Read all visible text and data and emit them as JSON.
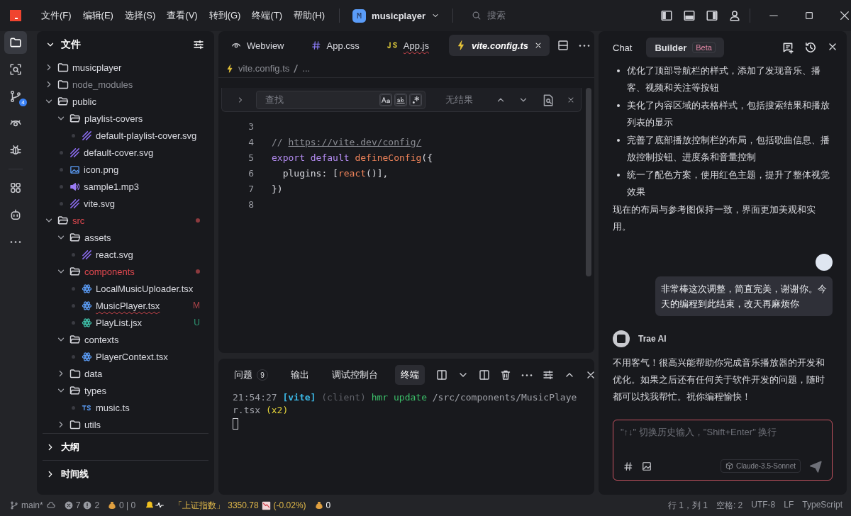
{
  "titlebar": {
    "menu": [
      "文件(F)",
      "编辑(E)",
      "选择(S)",
      "查看(V)",
      "转到(G)",
      "终端(T)",
      "帮助(H)"
    ],
    "project": {
      "initial": "M",
      "name": "musicplayer"
    },
    "search": {
      "placeholder": "搜索"
    }
  },
  "activity_bar": [
    {
      "kind": "files",
      "selected": true
    },
    {
      "kind": "search",
      "selected": false
    },
    {
      "kind": "git",
      "selected": false,
      "badge": "4"
    },
    {
      "kind": "remote",
      "selected": false
    },
    {
      "kind": "debug",
      "selected": false
    },
    {
      "kind": "extensions",
      "selected": false
    },
    {
      "kind": "robot",
      "selected": false
    },
    {
      "kind": "more",
      "selected": false
    }
  ],
  "explorer": {
    "title": "文件",
    "tree": [
      {
        "name": "musicplayer",
        "kind": "folder",
        "expanded": false,
        "problem": false,
        "ignored": false
      },
      {
        "name": "node_modules",
        "kind": "folder",
        "expanded": false,
        "problem": false,
        "ignored": true
      },
      {
        "name": "public",
        "kind": "folder",
        "expanded": true,
        "problem": false,
        "ignored": false,
        "children": [
          {
            "name": "playlist-covers",
            "kind": "folder",
            "expanded": true,
            "problem": false,
            "ignored": false,
            "children": [
              {
                "name": "default-playlist-cover.svg",
                "kind": "svg"
              }
            ]
          },
          {
            "name": "default-cover.svg",
            "kind": "svg"
          },
          {
            "name": "icon.png",
            "kind": "image"
          },
          {
            "name": "sample1.mp3",
            "kind": "audio"
          },
          {
            "name": "vite.svg",
            "kind": "svg"
          }
        ]
      },
      {
        "name": "src",
        "kind": "folder",
        "expanded": true,
        "problem": true,
        "ignored": false,
        "children": [
          {
            "name": "assets",
            "kind": "folder",
            "expanded": true,
            "problem": false,
            "ignored": false,
            "children": [
              {
                "name": "react.svg",
                "kind": "svg"
              }
            ]
          },
          {
            "name": "components",
            "kind": "folder",
            "expanded": true,
            "problem": true,
            "ignored": false,
            "children": [
              {
                "name": "LocalMusicUploader.tsx",
                "kind": "react"
              },
              {
                "name": "MusicPlayer.tsx",
                "kind": "react",
                "error": true,
                "status": "M"
              },
              {
                "name": "PlayList.jsx",
                "kind": "react-js",
                "status": "U"
              }
            ]
          },
          {
            "name": "contexts",
            "kind": "folder",
            "expanded": true,
            "problem": false,
            "ignored": false,
            "children": [
              {
                "name": "PlayerContext.tsx",
                "kind": "react"
              }
            ]
          },
          {
            "name": "data",
            "kind": "folder",
            "expanded": false,
            "problem": false,
            "ignored": false
          },
          {
            "name": "types",
            "kind": "folder",
            "expanded": true,
            "problem": false,
            "ignored": false,
            "children": [
              {
                "name": "music.ts",
                "kind": "ts"
              }
            ]
          },
          {
            "name": "utils",
            "kind": "folder",
            "expanded": false,
            "problem": false,
            "ignored": false
          }
        ]
      }
    ],
    "sections": [
      {
        "title": "大纲",
        "expanded": false
      },
      {
        "title": "时间线",
        "expanded": false
      }
    ]
  },
  "editor": {
    "tabs": [
      {
        "label": "Webview",
        "kind": "webview",
        "selected": false,
        "preview": false,
        "error": false
      },
      {
        "label": "App.css",
        "kind": "css",
        "selected": false,
        "preview": false,
        "error": false
      },
      {
        "label": "App.js",
        "kind": "js",
        "selected": false,
        "preview": false,
        "error": true
      },
      {
        "label": "vite.config.ts",
        "kind": "config",
        "selected": true,
        "preview": true,
        "error": false
      }
    ],
    "breadcrumb": [
      "vite.config.ts",
      "..."
    ],
    "find": {
      "placeholder": "查找",
      "result": "无结果"
    },
    "lines": [
      {
        "number": "3"
      },
      {
        "number": "4",
        "tokens": [
          {
            "text": "// ",
            "kind": "comment"
          },
          {
            "text": "https://vite.dev/config/",
            "kind": "link"
          }
        ]
      },
      {
        "number": "5",
        "tokens": [
          {
            "text": "export default ",
            "kind": "keyword"
          },
          {
            "text": "defineConfig",
            "kind": "function"
          },
          {
            "text": "({",
            "kind": "plain"
          }
        ]
      },
      {
        "number": "6",
        "tokens": [
          {
            "text": "  plugins: [",
            "kind": "plain"
          },
          {
            "text": "react",
            "kind": "function"
          },
          {
            "text": "()],",
            "kind": "plain"
          }
        ]
      },
      {
        "number": "7",
        "tokens": [
          {
            "text": "})",
            "kind": "plain"
          }
        ]
      },
      {
        "number": "8"
      }
    ]
  },
  "panel": {
    "tabs": [
      {
        "label": "问题",
        "badge": "9",
        "selected": false
      },
      {
        "label": "输出",
        "selected": false
      },
      {
        "label": "调试控制台",
        "selected": false
      },
      {
        "label": "终端",
        "selected": true
      }
    ],
    "output": [
      {
        "text": "21:54:27 ",
        "kind": "time"
      },
      {
        "text": "[vite]",
        "kind": "tag"
      },
      {
        "text": " (client)",
        "kind": "dim"
      },
      {
        "text": " hmr update",
        "kind": "ok"
      },
      {
        "text": " /src/components/MusicPlayer.tsx",
        "kind": "plain"
      },
      {
        "text": " (x2)",
        "kind": "count"
      }
    ]
  },
  "chat": {
    "tabs": [
      {
        "label": "Chat",
        "selected": false
      },
      {
        "label": "Builder",
        "selected": true,
        "badge": "Beta"
      }
    ],
    "bullets": [
      "优化了顶部导航栏的样式，添加了发现音乐、播客、视频和关注等按钮",
      "美化了内容区域的表格样式，包括搜索结果和播放列表的显示",
      "完善了底部播放控制栏的布局，包括歌曲信息、播放控制按钮、进度条和音量控制",
      "统一了配色方案，使用红色主题，提升了整体视觉效果"
    ],
    "summary": "现在的布局与参考图保持一致，界面更加美观和实用。",
    "user_message": "非常棒这次调整，简直完美，谢谢你。今天的编程到此结束，改天再麻烦你",
    "assistant": {
      "name": "Trae AI",
      "message": "不用客气！很高兴能帮助你完成音乐播放器的开发和优化。如果之后还有任何关于软件开发的问题，随时都可以找我帮忙。祝你编程愉快！"
    },
    "input": {
      "placeholder": "\"↑↓\" 切换历史输入，\"Shift+Enter\" 换行"
    },
    "model": "Claude-3.5-Sonnet"
  },
  "status_bar": {
    "branch": "main*",
    "errors": "7",
    "warnings": "2",
    "ports": "0 | 0",
    "index_name": "「上证指数」",
    "index_value": "3350.78",
    "index_change": "(-0.02%)",
    "coins": "0",
    "right": [
      "行 1，列 1",
      "空格: 2",
      "UTF-8",
      "LF",
      "TypeScript"
    ]
  }
}
